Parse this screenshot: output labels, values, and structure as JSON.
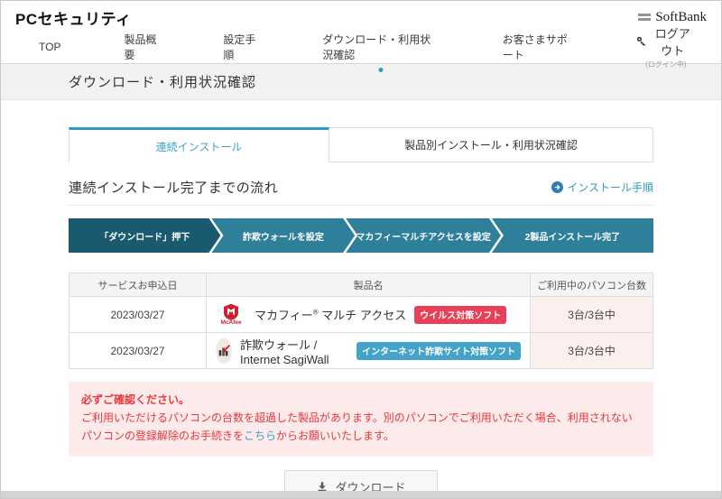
{
  "header": {
    "app_title": "PCセキュリティ",
    "brand": "SoftBank"
  },
  "nav": {
    "items": [
      {
        "label": "TOP",
        "active": false
      },
      {
        "label": "製品概要",
        "active": false
      },
      {
        "label": "設定手順",
        "active": false
      },
      {
        "label": "ダウンロード・利用状況確認",
        "active": true
      },
      {
        "label": "お客さまサポート",
        "active": false
      }
    ],
    "logout_label": "ログアウト",
    "login_status": "(ログイン中)"
  },
  "page": {
    "title": "ダウンロード・利用状況確認"
  },
  "tabs": [
    {
      "label": "連続インストール",
      "active": true
    },
    {
      "label": "製品別インストール・利用状況確認",
      "active": false
    }
  ],
  "flow": {
    "heading": "連続インストール完了までの流れ",
    "link_label": "インストール手順",
    "steps": [
      "「ダウンロード」押下",
      "詐欺ウォールを設定",
      "マカフィーマルチアクセスを設定",
      "2製品インストール完了"
    ]
  },
  "table": {
    "headers": [
      "サービスお申込日",
      "製品名",
      "ご利用中のパソコン台数"
    ],
    "rows": [
      {
        "date": "2023/03/27",
        "name": "マカフィー",
        "sup": "®",
        "name2": " マルチ アクセス",
        "logo_text": "McAfee",
        "badge": "ウイルス対策ソフト",
        "count": "3台/3台中"
      },
      {
        "date": "2023/03/27",
        "name": "詐欺ウォール / Internet SagiWall",
        "sup": "",
        "name2": "",
        "badge": "インターネット詐欺サイト対策ソフト",
        "count": "3台/3台中"
      }
    ]
  },
  "warning": {
    "title": "必ずご確認ください。",
    "body1": "ご利用いただけるパソコンの台数を超過した製品があります。別のパソコンでご利用いただく場合、利用されないパソコンの登録解除のお手続きを",
    "link": "こちら",
    "body2": "からお願いいたします。"
  },
  "download": {
    "label": "ダウンロード"
  },
  "icons": {
    "logout": "key-icon",
    "brand": "softbank-bars-icon",
    "install_link": "arrow-circle-icon",
    "row1_logo": "mcafee-shield-icon",
    "row2_logo": "sagiwall-icon",
    "download": "download-icon",
    "nav_active": "active-nav-dot"
  },
  "colors": {
    "accent_teal": "#2e9bc1",
    "flow_dark": "#1a5a6e",
    "flow_teal": "#2e7f99",
    "badge_red": "#e84056",
    "badge_blue": "#44a3c8",
    "warning_red": "#e8383d",
    "warning_bg": "#fdeaea",
    "count_cell_bg": "#fcf0ef"
  }
}
